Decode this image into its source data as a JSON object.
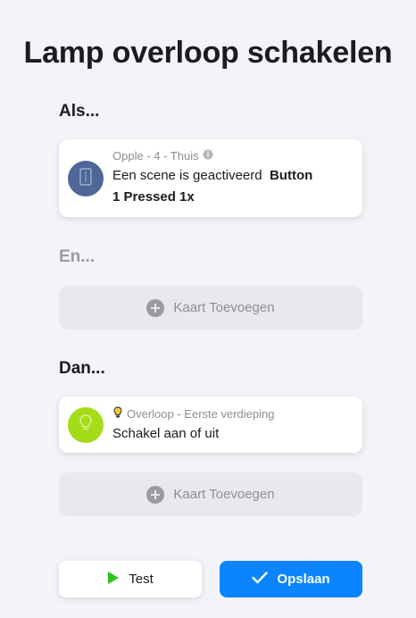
{
  "title": "Lamp overloop schakelen",
  "sections": {
    "if_label": "Als...",
    "and_label": "En...",
    "then_label": "Dan..."
  },
  "trigger_card": {
    "device": "Opple - 4 - Thuis",
    "line1_text": "Een scene is geactiveerd",
    "line1_bold": "Button",
    "line2_bold": "1 Pressed 1x",
    "avatar_color": "#4f6796",
    "icon": "opple-switch-icon",
    "info_icon": "info-icon"
  },
  "and_add": {
    "label": "Kaart Toevoegen",
    "icon": "plus-circle-icon"
  },
  "action_card": {
    "device": "Overloop - Eerste verdieping",
    "text": "Schakel aan of uit",
    "avatar_color": "#a4dd18",
    "icon": "lightbulb-icon"
  },
  "then_add": {
    "label": "Kaart Toevoegen",
    "icon": "plus-circle-icon"
  },
  "buttons": {
    "test_label": "Test",
    "test_icon_color": "#30c21e",
    "save_label": "Opslaan",
    "save_color": "#0a84ff"
  }
}
